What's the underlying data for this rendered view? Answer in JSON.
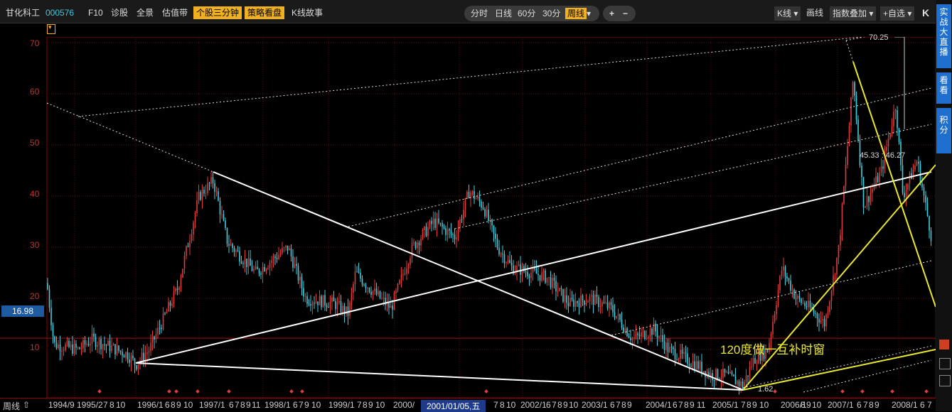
{
  "header": {
    "stock_name": "甘化科工",
    "stock_code": "000576",
    "menu": [
      "F10",
      "诊股",
      "全景",
      "估值带"
    ],
    "highlight1": "个股三分钟",
    "highlight2": "策略看盘",
    "kline_story": "K线故事"
  },
  "periods": {
    "items": [
      "分时",
      "日线",
      "60分",
      "30分"
    ],
    "active": "周线"
  },
  "zoom": {
    "plus": "+",
    "minus": "−"
  },
  "right_tools": {
    "kline": "K线",
    "draw": "画线",
    "overlay": "指数叠加",
    "watch": "+自选",
    "k": "K"
  },
  "sidebar": {
    "live": "实战大直播",
    "look": "看看",
    "points": "积分"
  },
  "axis": {
    "y_ticks": [
      "70",
      "60",
      "50",
      "40",
      "30",
      "20",
      "10"
    ],
    "price_tag": "16.98"
  },
  "annotations": {
    "high": "70.25",
    "mid": "45.33 : 46.27",
    "low": "1.62",
    "window_text": "120度做一互补时窗"
  },
  "bottom": {
    "period_label": "周线",
    "dates": [
      "1994/9",
      "1995/2",
      "7",
      "8",
      "10",
      "1996/1",
      "6",
      "8",
      "9",
      "10",
      "1997/1",
      "6",
      "7",
      "8",
      "9",
      "11",
      "1998/1",
      "6",
      "7",
      "9",
      "10",
      "1999/1",
      "7",
      "8",
      "9",
      "10",
      "2000/",
      "2001/01/05,五",
      "7",
      "8",
      "10",
      "2002/1",
      "6",
      "7",
      "8",
      "9",
      "10",
      "2003/1",
      "6",
      "7",
      "8",
      "9",
      "2004/1",
      "6",
      "7",
      "8",
      "9",
      "11",
      "2005/1",
      "7",
      "8",
      "9",
      "10",
      "2006/1",
      "8",
      "9",
      "10",
      "2007/1",
      "6",
      "7",
      "8",
      "9",
      "2008/1",
      "6",
      "7"
    ]
  },
  "colors": {
    "up": "#e03c3c",
    "down": "#40d0e0",
    "accent": "#f0b020",
    "trend": "#ffffff",
    "yellow": "#e8e830"
  }
}
